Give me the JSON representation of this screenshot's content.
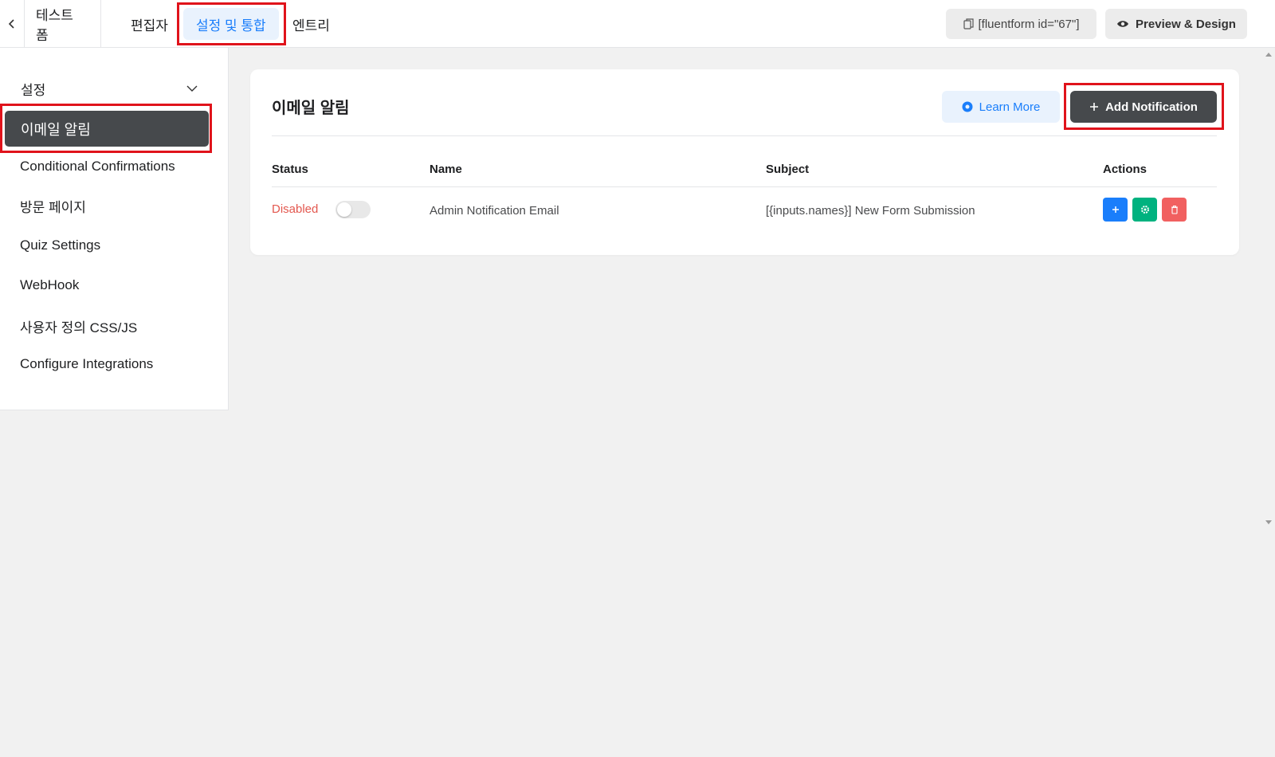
{
  "topbar": {
    "form_title": "테스트 폼",
    "tabs": [
      {
        "label": "편집자"
      },
      {
        "label": "설정 및 통합"
      },
      {
        "label": "엔트리"
      }
    ],
    "shortcode": "[fluentform id=\"67\"]",
    "preview_label": "Preview & Design"
  },
  "sidebar": {
    "header": "설정",
    "items": [
      {
        "label": "이메일 알림"
      },
      {
        "label": "Conditional Confirmations"
      },
      {
        "label": "방문 페이지"
      },
      {
        "label": "Quiz Settings"
      },
      {
        "label": "WebHook"
      },
      {
        "label": "사용자 정의 CSS/JS"
      },
      {
        "label": "Configure Integrations"
      }
    ]
  },
  "main": {
    "title": "이메일 알림",
    "learn_more_label": "Learn More",
    "add_notification_label": "Add Notification",
    "columns": [
      "Status",
      "Name",
      "Subject",
      "Actions"
    ],
    "rows": [
      {
        "status": "Disabled",
        "enabled": false,
        "name": "Admin Notification Email",
        "subject": "[{inputs.names}] New Form Submission"
      }
    ]
  },
  "colors": {
    "accent": "#1a7efb",
    "dark_button": "#46494c",
    "success": "#00b27f",
    "danger": "#f16060",
    "highlight": "#e0131b"
  }
}
